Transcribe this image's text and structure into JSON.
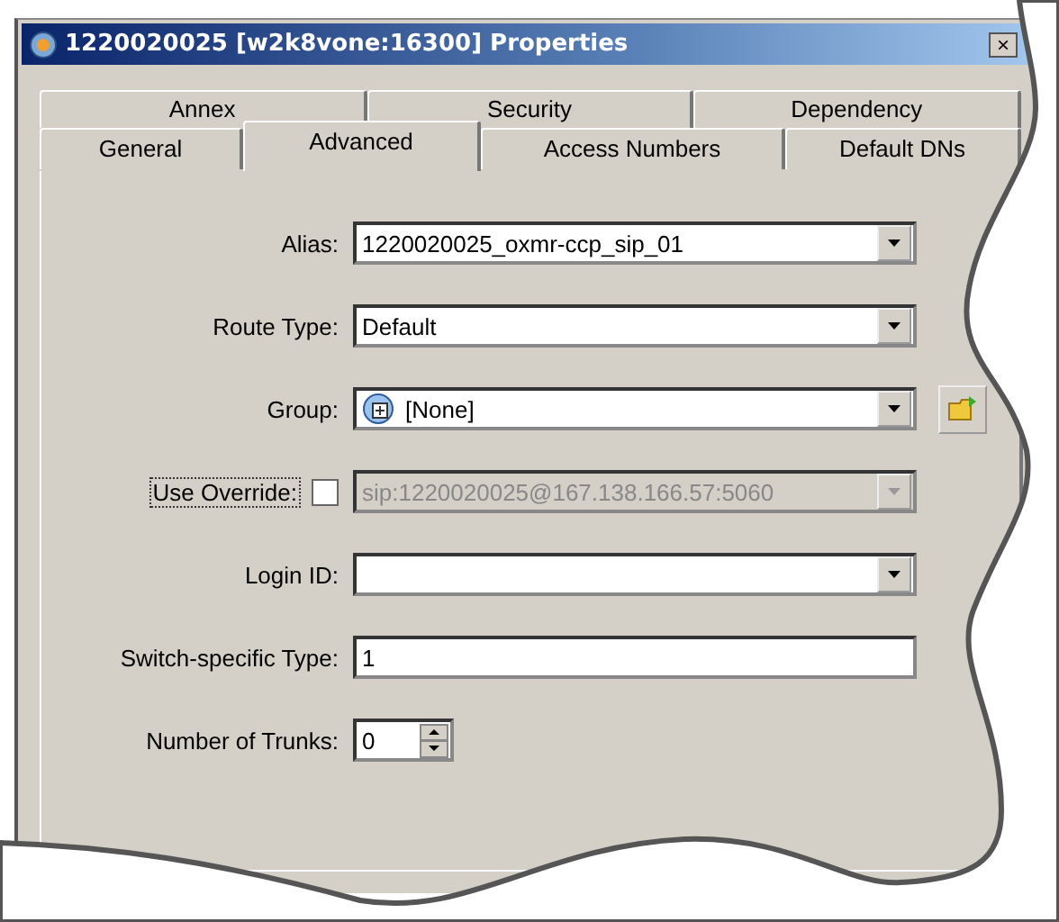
{
  "window": {
    "title": "1220020025 [w2k8vone:16300] Properties",
    "close": "×"
  },
  "tab_rows": [
    [
      {
        "label": "Annex",
        "selected": false
      },
      {
        "label": "Security",
        "selected": false
      },
      {
        "label": "Dependency",
        "selected": false
      }
    ],
    [
      {
        "label": "General",
        "selected": false
      },
      {
        "label": "Advanced",
        "selected": true
      },
      {
        "label": "Access Numbers",
        "selected": false
      },
      {
        "label": "Default DNs",
        "selected": false
      }
    ]
  ],
  "fields": [
    {
      "kind": "combo",
      "label": "Alias:",
      "value": "1220020025_oxmr-ccp_sip_01"
    },
    {
      "kind": "combo",
      "label": "Route Type:",
      "value": "Default"
    },
    {
      "kind": "group-combo",
      "label": "Group:",
      "value": "[None]"
    },
    {
      "kind": "checkbox-combo",
      "label": "Use Override:",
      "checked": false,
      "value": "sip:1220020025@167.138.166.57:5060",
      "disabled": true
    },
    {
      "kind": "combo",
      "label": "Login ID:"
    },
    {
      "kind": "text",
      "label": "Switch-specific Type:",
      "value": "1"
    },
    {
      "kind": "spinner",
      "label": "Number of Trunks:",
      "value": "0"
    }
  ]
}
